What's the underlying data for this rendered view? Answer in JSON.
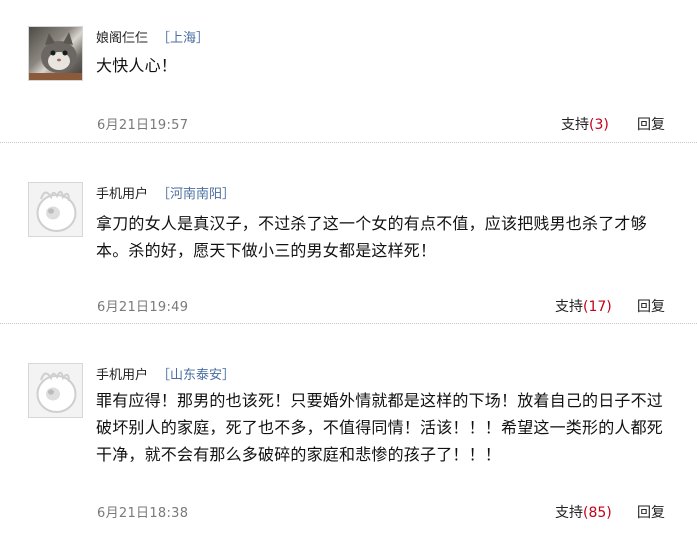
{
  "comments": [
    {
      "user": "娘阁仨仨",
      "location": "［上海］",
      "text": "大快人心！",
      "time": "6月21日19:57",
      "support_label": "支持",
      "support_count": "(3)",
      "reply_label": "回复",
      "avatar": "cat-photo-icon"
    },
    {
      "user": "手机用户",
      "location": "［河南南阳］",
      "text": "拿刀的女人是真汉子，不过杀了这一个女的有点不值，应该把贱男也杀了才够本。杀的好，愿天下做小三的男女都是这样死！",
      "time": "6月21日19:49",
      "support_label": "支持",
      "support_count": "(17)",
      "reply_label": "回复",
      "avatar": "default-avatar-icon"
    },
    {
      "user": "手机用户",
      "location": "［山东泰安］",
      "text": "罪有应得！那男的也该死！只要婚外情就都是这样的下场！放着自己的日子不过破坏别人的家庭，死了也不多，不值得同情！活该！！！希望这一类形的人都死干净，就不会有那么多破碎的家庭和悲惨的孩子了！！！",
      "time": "6月21日18:38",
      "support_label": "支持",
      "support_count": "(85)",
      "reply_label": "回复",
      "avatar": "default-avatar-icon"
    }
  ]
}
